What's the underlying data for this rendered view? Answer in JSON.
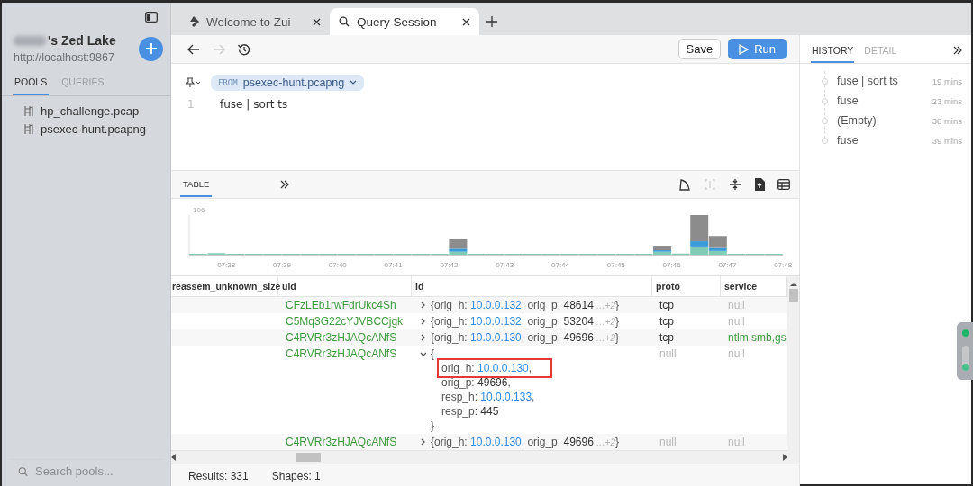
{
  "sidebar": {
    "lake_name": "'s Zed Lake",
    "lake_url": "http://localhost:9867",
    "tabs": [
      {
        "label": "POOLS",
        "selected": true
      },
      {
        "label": "QUERIES",
        "selected": false
      }
    ],
    "pools": [
      {
        "name": "hp_challenge.pcap"
      },
      {
        "name": "psexec-hunt.pcapng"
      }
    ],
    "search": {
      "placeholder": "Search pools..."
    }
  },
  "tabs": [
    {
      "label": "Welcome to Zui",
      "kind": "welcome",
      "selected": false
    },
    {
      "label": "Query Session",
      "kind": "query",
      "selected": true
    }
  ],
  "toolbar": {
    "forward_disabled": true,
    "save": "Save",
    "run": "Run"
  },
  "editor": {
    "from_label": "FROM",
    "pool": "psexec-hunt.pcapng",
    "lines": [
      {
        "number": "1",
        "code": "fuse | sort ts"
      }
    ]
  },
  "results": {
    "tabs": [
      {
        "label": "TABLE",
        "selected": true
      }
    ],
    "tools": [
      {
        "kind": "shark",
        "disabled": false
      },
      {
        "kind": "expand",
        "disabled": true
      },
      {
        "kind": "collapse",
        "disabled": false
      },
      {
        "kind": "export",
        "disabled": false
      },
      {
        "kind": "table",
        "disabled": false
      }
    ],
    "histogram": {
      "max_label": "106",
      "time_labels": [
        "07:38",
        "07:39",
        "07:40",
        "07:41",
        "07:42",
        "07:43",
        "07:44",
        "07:45",
        "07:46",
        "07:47",
        "07:48"
      ]
    },
    "table": {
      "columns": [
        "reassem_unknown_size",
        "uid",
        "id",
        "proto",
        "service"
      ],
      "rows": [
        {
          "uid": "CFzLEb1rwFdrUkc4Sh",
          "id": {
            "expanded": false,
            "lines": [
              {
                "highlighted": false,
                "segments": [
                  {
                    "t": "{orig_h: ",
                    "kind": "plain"
                  },
                  {
                    "t": "10.0.0.132",
                    "kind": "ip"
                  },
                  {
                    "t": ", orig_p: ",
                    "kind": "plain"
                  },
                  {
                    "t": "48614",
                    "kind": "number"
                  },
                  {
                    "t": " …+2",
                    "kind": "more"
                  },
                  {
                    "t": "}",
                    "kind": "plain"
                  }
                ]
              }
            ]
          },
          "proto": {
            "text": "tcp",
            "kind": "text"
          },
          "service": {
            "text": "null",
            "kind": "null"
          }
        },
        {
          "uid": "C5Mq3G22cYJVBCCjgk",
          "id": {
            "expanded": false,
            "lines": [
              {
                "highlighted": false,
                "segments": [
                  {
                    "t": "{orig_h: ",
                    "kind": "plain"
                  },
                  {
                    "t": "10.0.0.132",
                    "kind": "ip"
                  },
                  {
                    "t": ", orig_p: ",
                    "kind": "plain"
                  },
                  {
                    "t": "53204",
                    "kind": "number"
                  },
                  {
                    "t": " …+2",
                    "kind": "more"
                  },
                  {
                    "t": "}",
                    "kind": "plain"
                  }
                ]
              }
            ]
          },
          "proto": {
            "text": "tcp",
            "kind": "text"
          },
          "service": {
            "text": "null",
            "kind": "null"
          }
        },
        {
          "uid": "C4RVRr3zHJAQcANfS",
          "id": {
            "expanded": false,
            "lines": [
              {
                "highlighted": false,
                "segments": [
                  {
                    "t": "{orig_h: ",
                    "kind": "plain"
                  },
                  {
                    "t": "10.0.0.130",
                    "kind": "ip"
                  },
                  {
                    "t": ", orig_p: ",
                    "kind": "plain"
                  },
                  {
                    "t": "49696",
                    "kind": "number"
                  },
                  {
                    "t": " …+2",
                    "kind": "more"
                  },
                  {
                    "t": "}",
                    "kind": "plain"
                  }
                ]
              }
            ]
          },
          "proto": {
            "text": "tcp",
            "kind": "text"
          },
          "service": {
            "text": "ntlm,smb,gs",
            "kind": "set"
          }
        },
        {
          "uid": "C4RVRr3zHJAQcANfS",
          "id": {
            "expanded": true,
            "lines": [
              {
                "highlighted": false,
                "segments": [
                  {
                    "t": "{",
                    "kind": "plain"
                  }
                ]
              },
              {
                "highlighted": true,
                "segments": [
                  {
                    "t": "orig_h: ",
                    "kind": "plain"
                  },
                  {
                    "t": "10.0.0.130",
                    "kind": "ip"
                  },
                  {
                    "t": ",",
                    "kind": "plain"
                  }
                ]
              },
              {
                "highlighted": false,
                "segments": [
                  {
                    "t": "orig_p: ",
                    "kind": "plain"
                  },
                  {
                    "t": "49696",
                    "kind": "number"
                  },
                  {
                    "t": ",",
                    "kind": "plain"
                  }
                ]
              },
              {
                "highlighted": false,
                "segments": [
                  {
                    "t": "resp_h: ",
                    "kind": "plain"
                  },
                  {
                    "t": "10.0.0.133",
                    "kind": "ip"
                  },
                  {
                    "t": ",",
                    "kind": "plain"
                  }
                ]
              },
              {
                "highlighted": false,
                "segments": [
                  {
                    "t": "resp_p: ",
                    "kind": "plain"
                  },
                  {
                    "t": "445",
                    "kind": "number"
                  }
                ]
              },
              {
                "highlighted": false,
                "segments": [
                  {
                    "t": "}",
                    "kind": "plain"
                  }
                ]
              }
            ]
          },
          "proto": {
            "text": "null",
            "kind": "null"
          },
          "service": {
            "text": "null",
            "kind": "null"
          }
        },
        {
          "uid": "C4RVRr3zHJAQcANfS",
          "id": {
            "expanded": false,
            "lines": [
              {
                "highlighted": false,
                "segments": [
                  {
                    "t": "{orig_h: ",
                    "kind": "plain"
                  },
                  {
                    "t": "10.0.0.130",
                    "kind": "ip"
                  },
                  {
                    "t": ", orig_p: ",
                    "kind": "plain"
                  },
                  {
                    "t": "49696",
                    "kind": "number"
                  },
                  {
                    "t": " …+2",
                    "kind": "more"
                  },
                  {
                    "t": "}",
                    "kind": "plain"
                  }
                ]
              }
            ]
          },
          "proto": {
            "text": "null",
            "kind": "null"
          },
          "service": {
            "text": "null",
            "kind": "null"
          }
        }
      ]
    },
    "status": {
      "results": "Results: 331",
      "shapes": "Shapes: 1"
    }
  },
  "right_panel": {
    "tabs": [
      {
        "label": "HISTORY",
        "selected": true
      },
      {
        "label": "DETAIL",
        "selected": false
      }
    ],
    "history": [
      {
        "query": "fuse | sort ts",
        "time": "19 mins"
      },
      {
        "query": "fuse",
        "time": "23 mins"
      },
      {
        "query": "(Empty)",
        "time": "38 mins"
      },
      {
        "query": "fuse",
        "time": "39 mins"
      }
    ]
  }
}
